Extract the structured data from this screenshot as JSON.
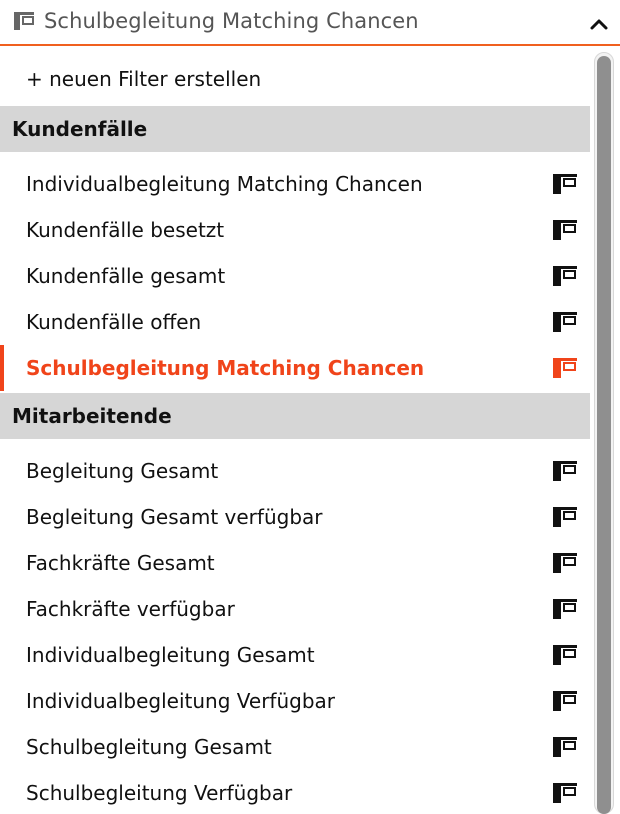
{
  "header": {
    "title": "Schulbegleitung Matching Chancen",
    "view_icon": "table-view-icon",
    "toggle_icon": "chevron-up-icon"
  },
  "create_filter": {
    "label": "+ neuen Filter erstellen"
  },
  "groups": [
    {
      "title": "Kundenfälle",
      "items": [
        {
          "label": "Individualbegleitung Matching Chancen",
          "active": false
        },
        {
          "label": "Kundenfälle besetzt",
          "active": false
        },
        {
          "label": "Kundenfälle gesamt",
          "active": false
        },
        {
          "label": "Kundenfälle offen",
          "active": false
        },
        {
          "label": "Schulbegleitung Matching Chancen",
          "active": true
        }
      ]
    },
    {
      "title": "Mitarbeitende",
      "items": [
        {
          "label": "Begleitung Gesamt",
          "active": false
        },
        {
          "label": "Begleitung Gesamt verfügbar",
          "active": false
        },
        {
          "label": "Fachkräfte Gesamt",
          "active": false
        },
        {
          "label": "Fachkräfte verfügbar",
          "active": false
        },
        {
          "label": "Individualbegleitung Gesamt",
          "active": false
        },
        {
          "label": "Individualbegleitung Verfügbar",
          "active": false
        },
        {
          "label": "Schulbegleitung Gesamt",
          "active": false
        },
        {
          "label": "Schulbegleitung Verfügbar",
          "active": false
        }
      ]
    }
  ],
  "colors": {
    "accent": "#f0441a",
    "header_border": "#f0601f",
    "group_background": "#d6d6d6",
    "text": "#111111"
  }
}
